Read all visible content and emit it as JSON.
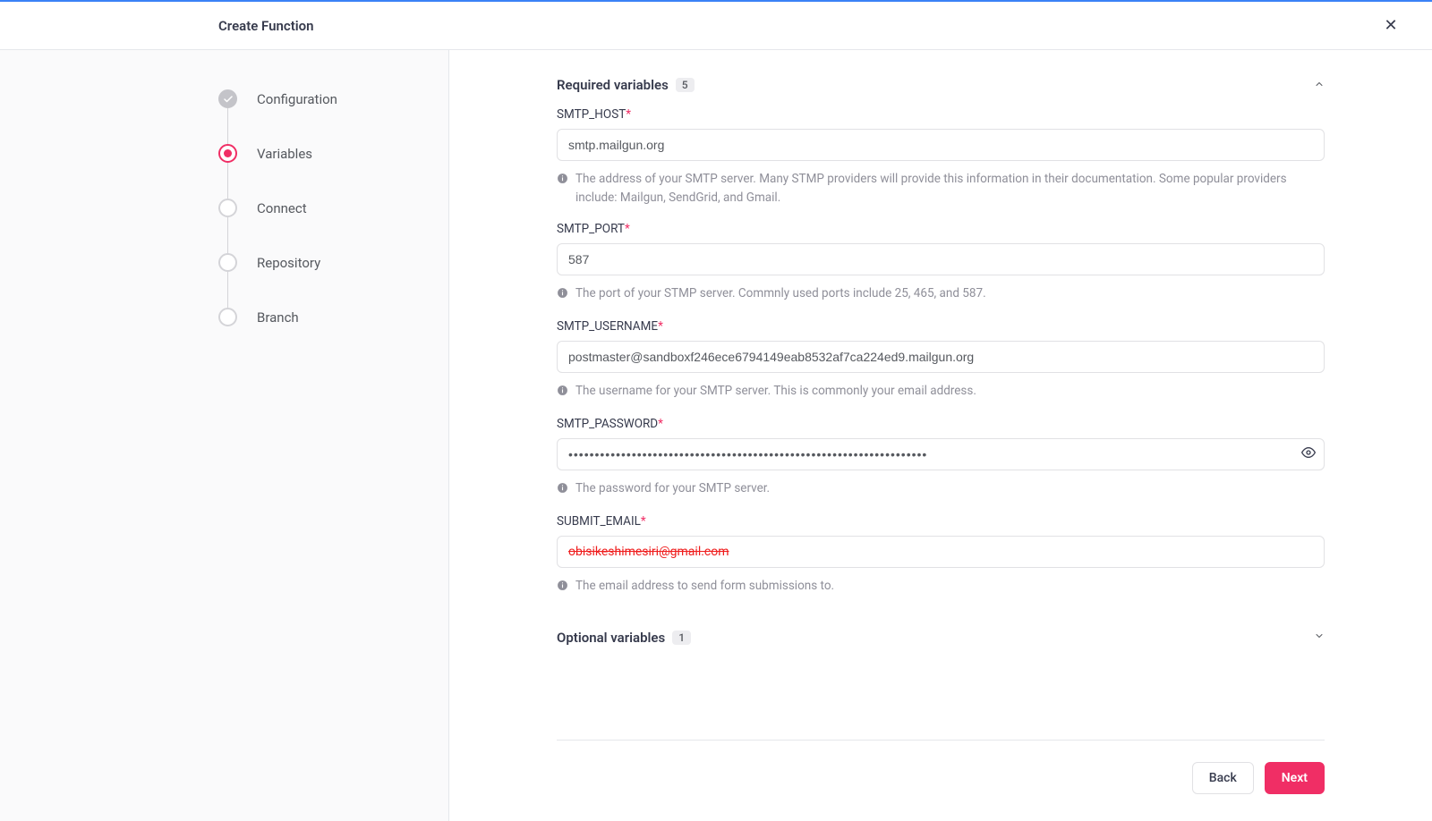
{
  "header": {
    "title": "Create Function"
  },
  "sidebar": {
    "steps": [
      {
        "label": "Configuration",
        "state": "completed"
      },
      {
        "label": "Variables",
        "state": "active"
      },
      {
        "label": "Connect",
        "state": "upcoming"
      },
      {
        "label": "Repository",
        "state": "upcoming"
      },
      {
        "label": "Branch",
        "state": "upcoming"
      }
    ]
  },
  "sections": {
    "required": {
      "title": "Required variables",
      "count": "5"
    },
    "optional": {
      "title": "Optional variables",
      "count": "1"
    }
  },
  "fields": {
    "smtp_host": {
      "label": "SMTP_HOST",
      "value": "smtp.mailgun.org",
      "helper": "The address of your SMTP server. Many STMP providers will provide this information in their documentation. Some popular providers include: Mailgun, SendGrid, and Gmail."
    },
    "smtp_port": {
      "label": "SMTP_PORT",
      "value": "587",
      "helper": "The port of your STMP server. Commnly used ports include 25, 465, and 587."
    },
    "smtp_username": {
      "label": "SMTP_USERNAME",
      "value": "postmaster@sandboxf246ece6794149eab8532af7ca224ed9.mailgun.org",
      "helper": "The username for your SMTP server. This is commonly your email address."
    },
    "smtp_password": {
      "label": "SMTP_PASSWORD",
      "value": "••••••••••••••••••••••••••••••••••••••••••••••••••••••••••••••••••••",
      "helper": "The password for your SMTP server."
    },
    "submit_email": {
      "label": "SUBMIT_EMAIL",
      "value": "obisikeshimesiri@gmail.com",
      "helper": "The email address to send form submissions to."
    }
  },
  "footer": {
    "back": "Back",
    "next": "Next"
  },
  "icons": {
    "close": "✕"
  }
}
